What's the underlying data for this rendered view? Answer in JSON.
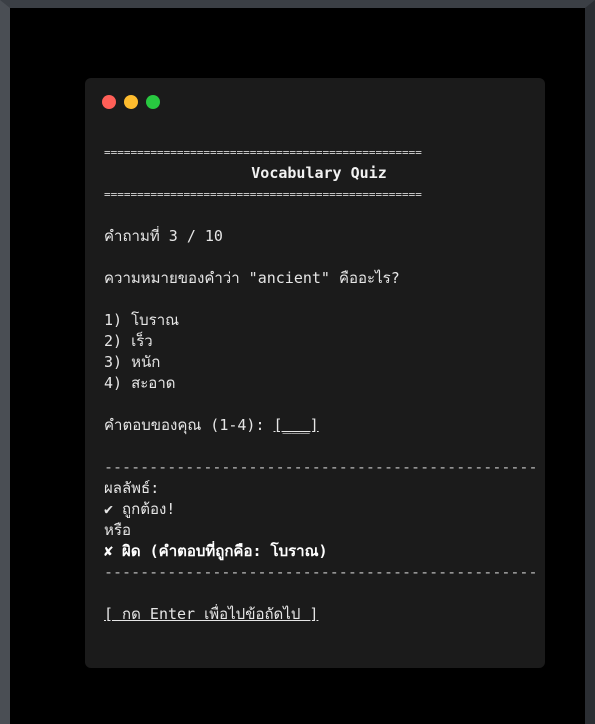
{
  "window": {
    "colors": {
      "close": "#ff5f57",
      "minimize": "#febc2e",
      "maximize": "#28c840"
    }
  },
  "quiz": {
    "rule_top": "================================================",
    "title": "Vocabulary Quiz",
    "rule_bottom": "================================================",
    "question_counter": "คำถามที่ 3 / 10",
    "question_text": "ความหมายของคำว่า \"ancient\" คืออะไร?",
    "options": [
      "1) โบราณ",
      "2) เร็ว",
      "3) หนัก",
      "4) สะอาด"
    ],
    "answer_prompt": "คำตอบของคุณ (1-4): ",
    "answer_input": "[___]",
    "rule_dash_top": "--------------------------------------------------",
    "result_label": "ผลลัพธ์:",
    "correct_text": "✔ ถูกต้อง!",
    "or_text": "หรือ",
    "wrong_text": "✘ ผิด (คำตอบที่ถูกคือ: โบราณ)",
    "rule_dash_bottom": "--------------------------------------------------",
    "continue_link": "[ กด Enter เพื่อไปข้อถัดไป ]"
  }
}
